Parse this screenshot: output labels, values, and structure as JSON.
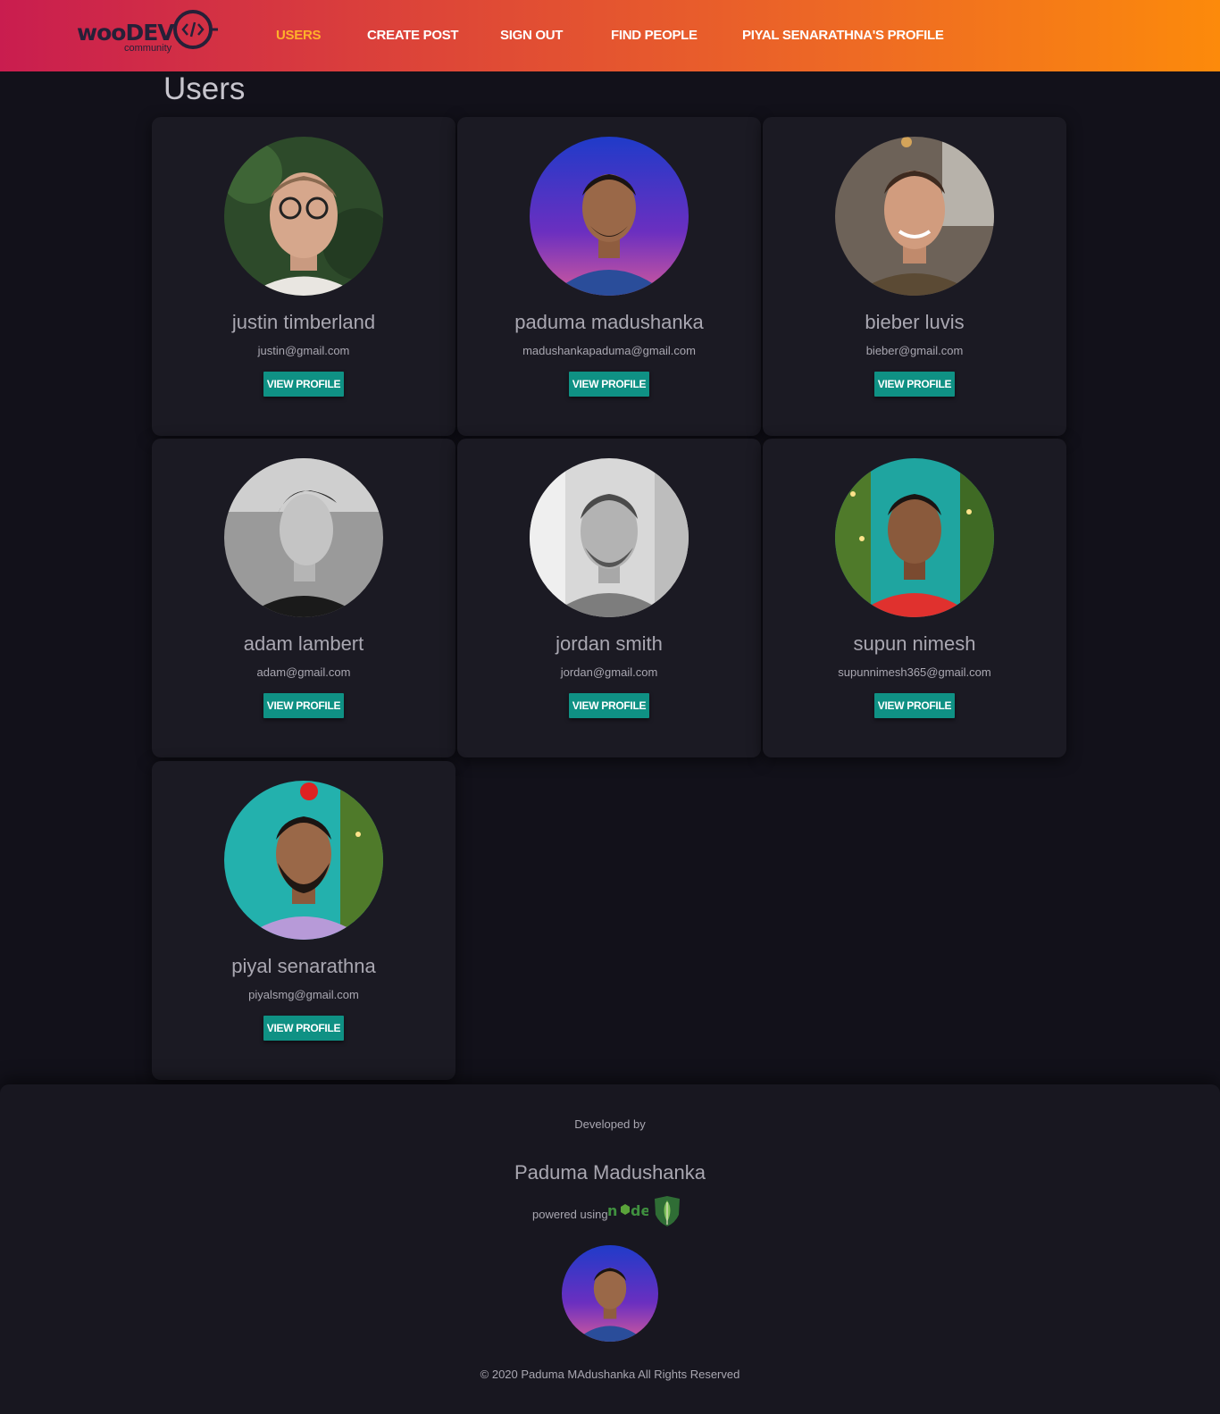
{
  "nav": {
    "logo_text": "wooDEV",
    "logo_sub": "community",
    "items": [
      {
        "label": "Users",
        "active": true
      },
      {
        "label": "Create Post"
      },
      {
        "label": "Sign Out"
      },
      {
        "label": "Find People"
      },
      {
        "label": "Piyal Senarathna's Profile"
      }
    ]
  },
  "page": {
    "title": "Users"
  },
  "button_label": "View Profile",
  "users": [
    {
      "name": "justin timberland",
      "email": "justin@gmail.com"
    },
    {
      "name": "paduma madushanka",
      "email": "madushankapaduma@gmail.com"
    },
    {
      "name": "bieber luvis",
      "email": "bieber@gmail.com"
    },
    {
      "name": "adam lambert",
      "email": "adam@gmail.com"
    },
    {
      "name": "jordan smith",
      "email": "jordan@gmail.com"
    },
    {
      "name": "supun nimesh",
      "email": "supunnimesh365@gmail.com"
    },
    {
      "name": "piyal senarathna",
      "email": "piyalsmg@gmail.com"
    }
  ],
  "footer": {
    "developed_by": "Developed by",
    "developer": "Paduma Madushanka",
    "powered": "powered using",
    "copyright": "© 2020 Paduma MAdushanka All Rights Reserved"
  },
  "colors": {
    "nav_gradient_start": "#c91d4f",
    "nav_gradient_end": "#fc8a0b",
    "nav_active": "#ffb12a",
    "button": "#0f9184",
    "background": "#12111a",
    "card": "#1b1a23"
  },
  "icons": {
    "logo": "code-brackets-icon",
    "node": "nodejs-logo",
    "mongo": "mongodb-leaf-icon"
  }
}
